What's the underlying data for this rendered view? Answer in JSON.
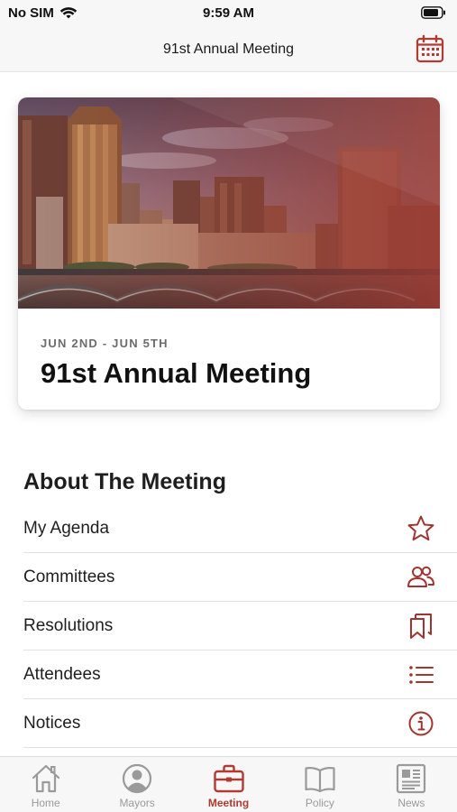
{
  "status_bar": {
    "carrier": "No SIM",
    "time": "9:59 AM"
  },
  "nav": {
    "title": "91st Annual Meeting"
  },
  "event_card": {
    "dates": "JUN 2ND - JUN 5TH",
    "title": "91st Annual Meeting"
  },
  "section": {
    "heading": "About The Meeting",
    "items": [
      {
        "label": "My Agenda",
        "icon": "star-icon"
      },
      {
        "label": "Committees",
        "icon": "people-icon"
      },
      {
        "label": "Resolutions",
        "icon": "bookmarks-icon"
      },
      {
        "label": "Attendees",
        "icon": "list-icon"
      },
      {
        "label": "Notices",
        "icon": "info-icon"
      }
    ]
  },
  "tabs": [
    {
      "label": "Home",
      "icon": "home-icon"
    },
    {
      "label": "Mayors",
      "icon": "person-icon"
    },
    {
      "label": "Meeting",
      "icon": "briefcase-icon",
      "active": true
    },
    {
      "label": "Policy",
      "icon": "book-icon"
    },
    {
      "label": "News",
      "icon": "newspaper-icon"
    }
  ],
  "colors": {
    "accent": "#b13a32",
    "inactive": "#9a9a9a"
  }
}
